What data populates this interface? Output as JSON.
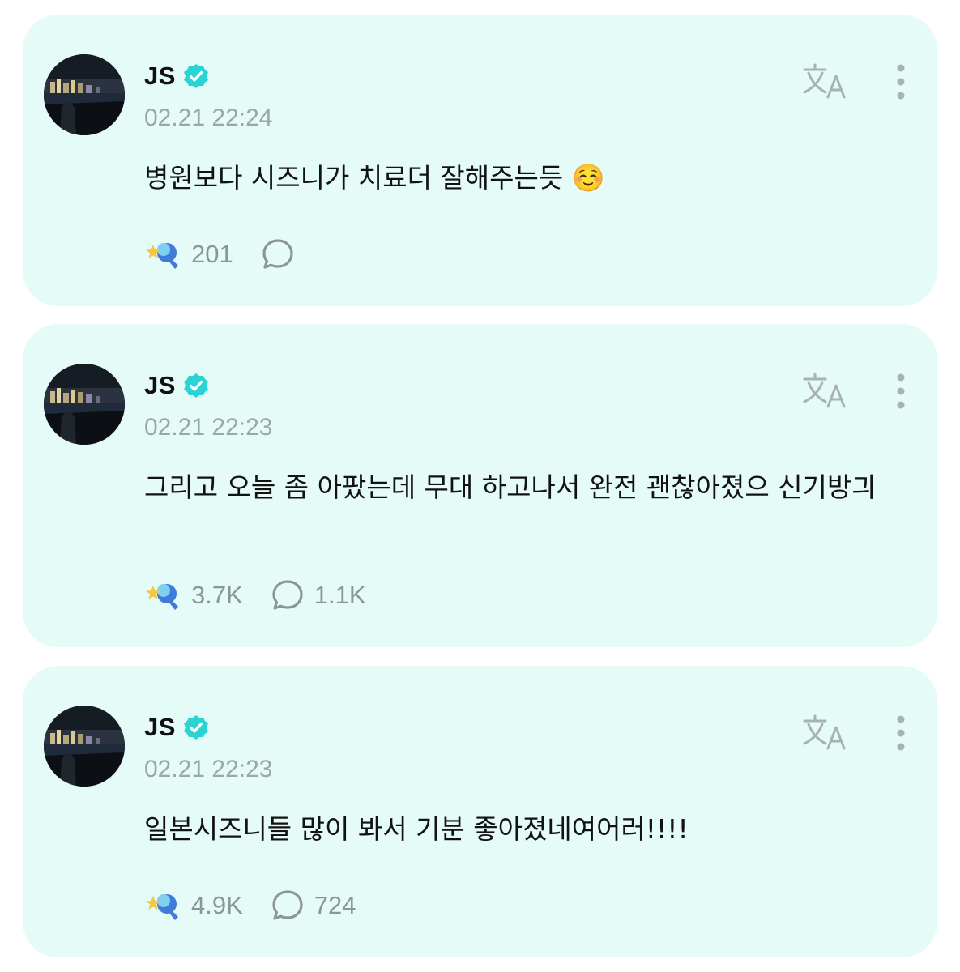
{
  "posts": [
    {
      "author": "JS",
      "timestamp": "02.21 22:24",
      "text": "병원보다 시즈니가 치료더 잘해주는듯 ☺️",
      "reactions": "201",
      "comments": ""
    },
    {
      "author": "JS",
      "timestamp": "02.21 22:23",
      "text": "그리고 오늘 좀 아팠는데 무대 하고나서 완전 괜찮아졌으 신기방긔",
      "reactions": "3.7K",
      "comments": "1.1K"
    },
    {
      "author": "JS",
      "timestamp": "02.21 22:23",
      "text": "일본시즈니들 많이 봐서 기분 좋아졌네여어러!!!!",
      "reactions": "4.9K",
      "comments": "724"
    }
  ],
  "icons": {
    "verified": "verified-badge-icon",
    "translate": "translate-icon",
    "more": "more-vertical-icon",
    "reaction": "star-lightstick-icon",
    "comment": "comment-bubble-icon"
  },
  "colors": {
    "card_bg": "#e5fbf7",
    "verified": "#2ad4d4",
    "icon_gray": "#8b9696",
    "reaction_star": "#f3c74a",
    "reaction_blue": "#3f7bd8"
  }
}
